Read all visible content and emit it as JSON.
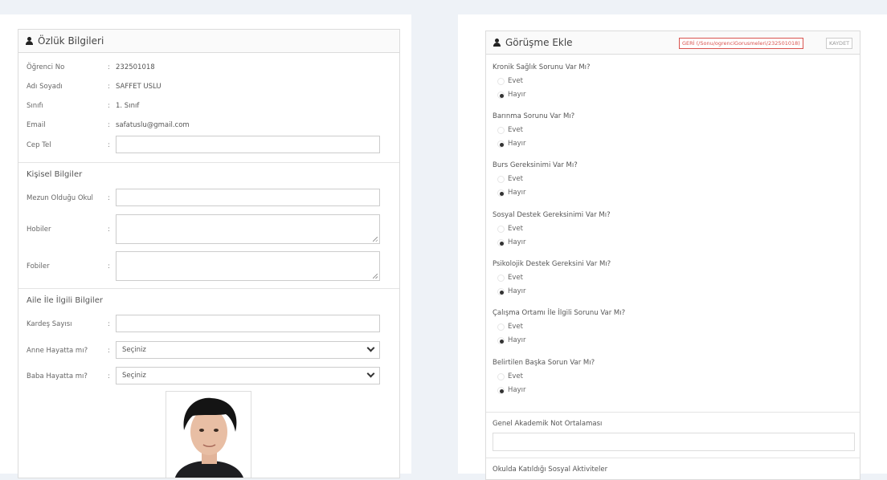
{
  "personal": {
    "title": "Özlük Bilgileri",
    "fields": [
      {
        "label": "Öğrenci No",
        "value": "232501018"
      },
      {
        "label": "Adı Soyadı",
        "value": "SAFFET USLU"
      },
      {
        "label": "Sınıfı",
        "value": "1. Sınıf"
      },
      {
        "label": "Email",
        "value": "safatuslu@gmail.com"
      }
    ],
    "phone_label": "Cep Tel",
    "colon": ":",
    "section_personal": "Kişisel Bilgiler",
    "graduated_label": "Mezun Olduğu Okul",
    "hobbies_label": "Hobiler",
    "phobias_label": "Fobiler",
    "section_family": "Aile İle İlgili Bilgiler",
    "siblings_label": "Kardeş Sayısı",
    "mother_label": "Anne Hayatta mı?",
    "father_label": "Baba Hayatta mı?",
    "select_value": "Seçiniz"
  },
  "interview": {
    "title": "Görüşme Ekle",
    "back_button": "GERİ (/Sonu/ogrenciGorusmeleri/232501018)",
    "save_button": "KAYDET",
    "yes_label": "Evet",
    "no_label": "Hayır",
    "questions": [
      "Kronik Sağlık Sorunu Var Mı?",
      "Barınma Sorunu Var Mı?",
      "Burs Gereksinimi Var Mı?",
      "Sosyal Destek Gereksinimi Var Mı?",
      "Psikolojik Destek Gereksini Var Mı?",
      "Çalışma Ortamı İle İlgili Sorunu Var Mı?",
      "Belirtilen Başka Sorun Var Mı?"
    ],
    "gpa_label": "Genel Akademik Not Ortalaması",
    "activities_label": "Okulda Katıldığı Sosyal Aktiviteler"
  }
}
